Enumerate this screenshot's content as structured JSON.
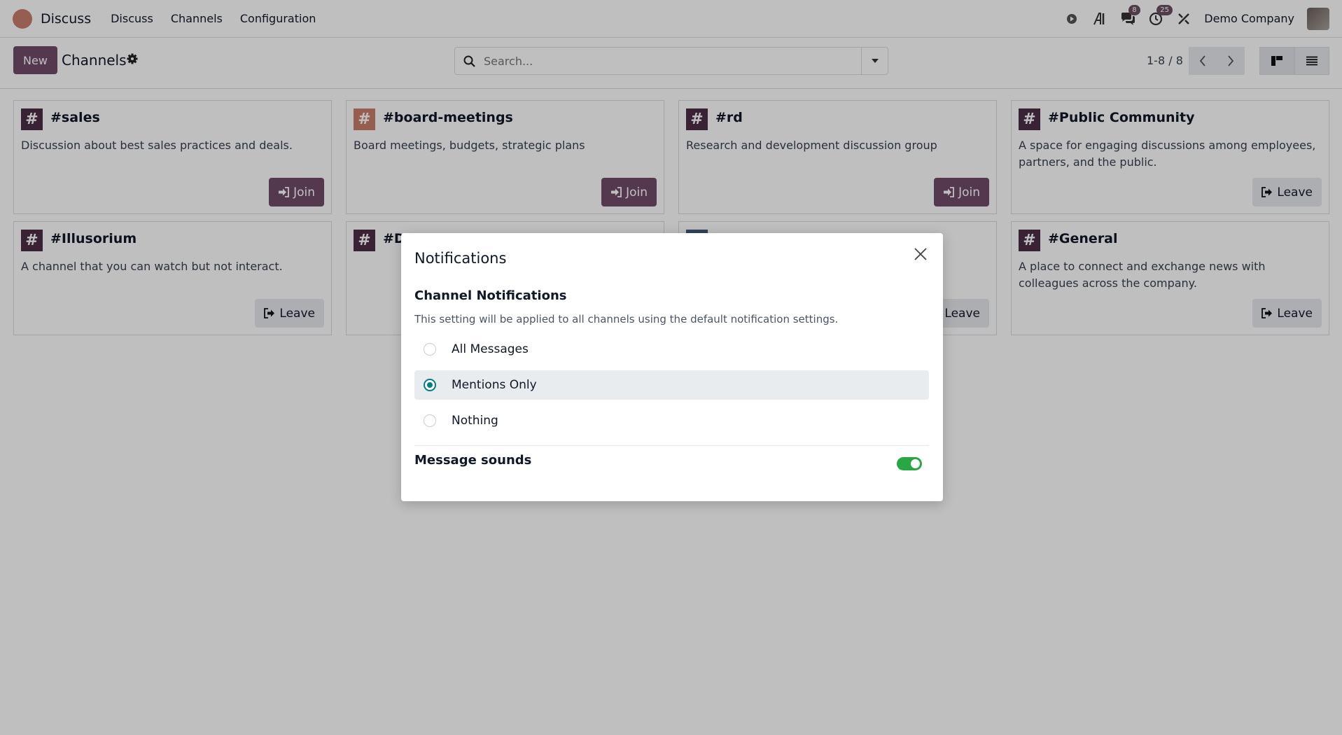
{
  "navbar": {
    "app_name": "Discuss",
    "menu": [
      "Discuss",
      "Channels",
      "Configuration"
    ],
    "messages_badge": "8",
    "activities_badge": "25",
    "company": "Demo Company"
  },
  "control": {
    "new_label": "New",
    "title": "Channels",
    "search_placeholder": "Search...",
    "pager": "1-8 / 8"
  },
  "cards": [
    {
      "name": "#sales",
      "desc": "Discussion about best sales practices and deals.",
      "action": "Join"
    },
    {
      "name": "#board-meetings",
      "desc": "Board meetings, budgets, strategic plans",
      "action": "Join"
    },
    {
      "name": "#rd",
      "desc": "Research and development discussion group",
      "action": "Join"
    },
    {
      "name": "#Public Community",
      "desc": "A space for engaging discussions among employees, partners, and the public.",
      "action": "Leave"
    },
    {
      "name": "#Illusorium",
      "desc": "A channel that you can watch but not interact.",
      "action": "Leave"
    },
    {
      "name": "#D",
      "desc": "",
      "action": ""
    },
    {
      "name": "",
      "desc": "",
      "action": "Leave"
    },
    {
      "name": "#General",
      "desc": "A place to connect and exchange news with colleagues across the company.",
      "action": "Leave"
    }
  ],
  "modal": {
    "title": "Notifications",
    "section_title": "Channel Notifications",
    "section_desc": "This setting will be applied to all channels using the default notification settings.",
    "options": [
      "All Messages",
      "Mentions Only",
      "Nothing"
    ],
    "selected": "Mentions Only",
    "sounds_label": "Message sounds",
    "sounds_enabled": true
  },
  "colors": {
    "brand": "#714b67",
    "radio_checked": "#017e84",
    "toggle_on": "#28a745"
  }
}
